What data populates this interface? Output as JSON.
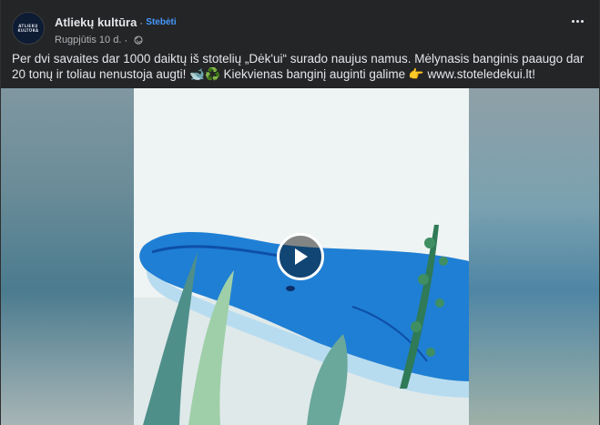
{
  "post": {
    "page_name": "Atliekų kultūra",
    "separator": "·",
    "follow_label": "Stebėti",
    "date": "Rugpjūtis 10 d.",
    "meta_separator": "·",
    "text": "Per dvi savaites dar 1000 daiktų iš stotelių „Dėk'ui“ surado naujus namus. Mėlynasis banginis paaugo dar 20 tonų ir toliau nenustoja augti! 🐋♻️ Kiekvienas banginį auginti galime 👉 www.stoteledekui.lt!"
  },
  "avatar": {
    "line1": "ATLIEKŲ",
    "line2": "KULTŪRA"
  },
  "icons": {
    "privacy": "globe-icon",
    "more": "more-options-icon",
    "play": "play-icon"
  },
  "colors": {
    "background": "#242526",
    "text": "#e4e6eb",
    "muted": "#b0b3b8",
    "link": "#4599ff",
    "whale": "#1f7fd4"
  }
}
